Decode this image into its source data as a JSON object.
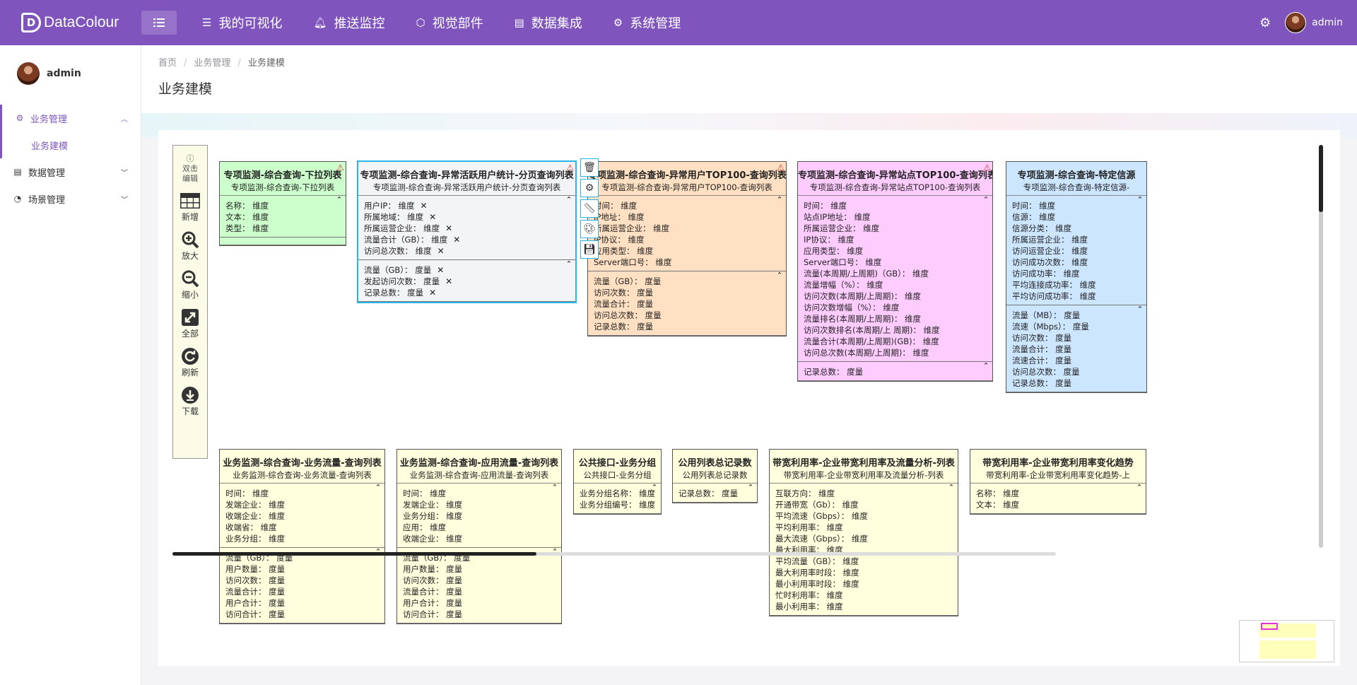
{
  "app": {
    "name": "DataColour",
    "logo_letter": "D"
  },
  "topnav": [
    {
      "icon": "list-icon",
      "label": "我的可视化"
    },
    {
      "icon": "bell-icon",
      "label": "推送监控"
    },
    {
      "icon": "cube-icon",
      "label": "视觉部件"
    },
    {
      "icon": "database-icon",
      "label": "数据集成"
    },
    {
      "icon": "gear-icon",
      "label": "系统管理"
    }
  ],
  "user": {
    "name": "admin"
  },
  "sidebar": {
    "user": "admin",
    "items": [
      {
        "label": "业务管理",
        "expanded": true
      },
      {
        "label": "业务建模",
        "sub": true
      },
      {
        "label": "数据管理"
      },
      {
        "label": "场景管理"
      }
    ]
  },
  "breadcrumb": [
    "首页",
    "业务管理",
    "业务建模"
  ],
  "page_title": "业务建模",
  "toolbox": {
    "hint": "双击编辑",
    "tools": [
      "新增",
      "放大",
      "缩小",
      "全部",
      "刷新",
      "下载"
    ]
  },
  "tables": [
    {
      "title": "专项监测-综合查询-下拉列表",
      "subtitle": "专项监测-综合查询-下拉列表",
      "sections": [
        [
          "名称： 维度",
          "文本： 维度",
          "类型： 维度"
        ],
        []
      ]
    },
    {
      "title": "专项监测-综合查询-异常活跃用户统计-分页查询列表",
      "subtitle": "专项监测-综合查询-异常活跃用户统计-分页查询列表",
      "sections": [
        [
          "用户IP： 维度",
          "所属地域： 维度",
          "所属运营企业： 维度",
          "流量合计（GB）： 维度",
          "访问总次数： 维度"
        ],
        [
          "流量（GB）： 度量",
          "发起访问次数： 度量",
          "记录总数： 度量"
        ]
      ]
    },
    {
      "title": "专项监测-综合查询-异常用户TOP100-查询列表",
      "subtitle": "专项监测-综合查询-异常用户TOP100-查询列表",
      "sections": [
        [
          "时间： 维度",
          "IP地址： 维度",
          "所属运营企业： 维度",
          "IP协议： 维度",
          "应用类型： 维度",
          "Server端口号： 维度"
        ],
        [
          "流量（GB）： 度量",
          "访问次数： 度量",
          "流量合计： 度量",
          "访问总次数： 度量",
          "记录总数： 度量"
        ]
      ]
    },
    {
      "title": "专项监测-综合查询-异常站点TOP100-查询列表",
      "subtitle": "专项监测-综合查询-异常站点TOP100-查询列表",
      "sections": [
        [
          "时间： 维度",
          "站点IP地址： 维度",
          "所属运营企业： 维度",
          "IP协议： 维度",
          "应用类型： 维度",
          "Server端口号： 维度",
          "流量(本周期/上周期)（GB）： 维度",
          "流量增幅（%）： 维度",
          "访问次数(本周期/上周期)： 维度",
          "访问次数增幅（%）： 维度",
          "流量排名(本周期/上周期)： 维度",
          "访问次数排名(本周期/上 周期)： 维度",
          "流量合计(本周期/上周期)(GB)： 维度",
          "访问总次数(本周期/上周期)： 维度"
        ],
        [
          "记录总数： 度量"
        ]
      ]
    },
    {
      "title": "专项监测-综合查询-特定信源",
      "subtitle": "专项监测-综合查询-特定信源-",
      "sections": [
        [
          "时间： 维度",
          "信源： 维度",
          "信源分类： 维度",
          "所属运营企业： 维度",
          "访问运营企业： 维度",
          "访问成功次数： 维度",
          "访问成功率： 维度",
          "平均连接成功率： 维度",
          "平均访问成功率： 维度"
        ],
        [
          "流量（MB）： 度量",
          "流速（Mbps）： 度量",
          "访问次数： 度量",
          "流量合计： 度量",
          "流速合计： 度量",
          "访问总次数： 度量",
          "记录总数： 度量"
        ]
      ]
    },
    {
      "title": "业务监测-综合查询-业务流量-查询列表",
      "subtitle": "业务监测-综合查询-业务流量-查询列表",
      "sections": [
        [
          "时间： 维度",
          "发端企业： 维度",
          "收端企业： 维度",
          "收端省： 维度",
          "业务分组： 维度"
        ],
        [
          "流量（GB）： 度量",
          "用户数量： 度量",
          "访问次数： 度量",
          "流量合计： 度量",
          "用户合计： 度量",
          "访问合计： 度量"
        ]
      ]
    },
    {
      "title": "业务监测-综合查询-应用流量-查询列表",
      "subtitle": "业务监测-综合查询-应用流量-查询列表",
      "sections": [
        [
          "时间： 维度",
          "发端企业： 维度",
          "业务分组： 维度",
          "应用： 维度",
          "收端企业： 维度"
        ],
        [
          "流量（GB）： 度量",
          "用户数量： 度量",
          "访问次数： 度量",
          "流量合计： 度量",
          "用户合计： 度量",
          "访问合计： 度量"
        ]
      ]
    },
    {
      "title": "公共接口-业务分组",
      "subtitle": "公共接口-业务分组",
      "sections": [
        [
          "业务分组名称： 维度",
          "业务分组编号： 维度"
        ]
      ]
    },
    {
      "title": "公用列表总记录数",
      "subtitle": "公用列表总记录数",
      "sections": [
        [
          "记录总数： 度量"
        ]
      ]
    },
    {
      "title": "带宽利用率-企业带宽利用率及流量分析-列表",
      "subtitle": "带宽利用率-企业带宽利用率及流量分析-列表",
      "sections": [
        [
          "互联方向： 维度",
          "开通带宽（Gb）： 维度",
          "平均流速（Gbps）： 维度",
          "平均利用率： 维度",
          "最大流速（Gbps）： 维度",
          "最大利用率： 维度",
          "平均流量（GB）： 维度",
          "最大利用率时段： 维度",
          "最小利用率时段： 维度",
          "忙时利用率： 维度",
          "最小利用率： 维度"
        ]
      ]
    },
    {
      "title": "带宽利用率-企业带宽利用率变化趋势",
      "subtitle": "带宽利用率-企业带宽利用率变化趋势-上",
      "sections": [
        [
          "名称： 维度",
          "文本： 维度"
        ]
      ]
    }
  ]
}
